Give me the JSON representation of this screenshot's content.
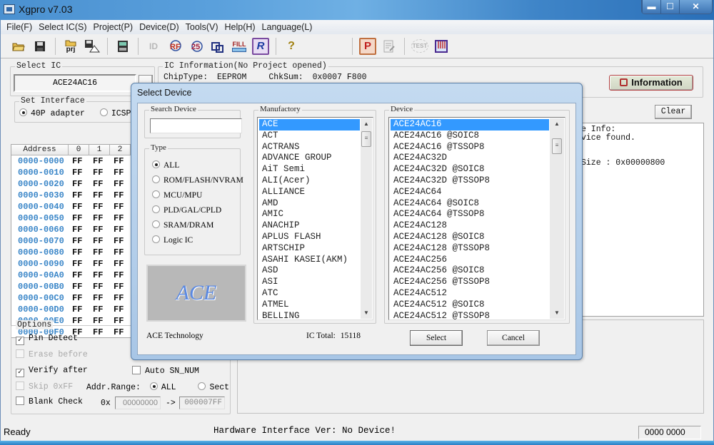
{
  "window": {
    "title": "Xgpro v7.03",
    "minimize": "▬",
    "maximize": "☐",
    "close": "✕"
  },
  "menu": [
    "File(F)",
    "Select IC(S)",
    "Project(P)",
    "Device(D)",
    "Tools(V)",
    "Help(H)",
    "Language(L)"
  ],
  "toolbar": {
    "icons": [
      "open-folder-icon",
      "save-icon",
      "open-project-icon",
      "save-project-icon",
      "chip-read-icon",
      "read-disabled-icon",
      "verify-icon",
      "blank-check-icon",
      "erase-icon",
      "fill-icon",
      "read-id-icon",
      "help-icon",
      "program-icon",
      "edit-disabled-icon",
      "test-icon",
      "chip-pins-icon"
    ],
    "fill_label": "FILL",
    "prj_label": "prj",
    "r_label": "R",
    "p_label": "P",
    "test_label": "TEST",
    "help_glyph": "?"
  },
  "select_ic": {
    "legend": "Select IC",
    "value": "ACE24AC16"
  },
  "ic_info": {
    "legend": "IC Information(No Project opened)",
    "chip_type_label": "ChipType:",
    "chip_type": "EEPROM",
    "chksum_label": "ChkSum:",
    "chksum": "0x0007 F800",
    "information_button": "Information"
  },
  "set_interface": {
    "legend": "Set Interface",
    "options": [
      {
        "label": "40P adapter",
        "selected": true
      },
      {
        "label": "ICSP po",
        "selected": false
      }
    ]
  },
  "hex_table": {
    "headers": [
      "Address",
      "0",
      "1",
      "2"
    ],
    "rows": [
      {
        "addr": "0000-0000",
        "cells": [
          "FF",
          "FF",
          "FF"
        ]
      },
      {
        "addr": "0000-0010",
        "cells": [
          "FF",
          "FF",
          "FF"
        ]
      },
      {
        "addr": "0000-0020",
        "cells": [
          "FF",
          "FF",
          "FF"
        ]
      },
      {
        "addr": "0000-0030",
        "cells": [
          "FF",
          "FF",
          "FF"
        ]
      },
      {
        "addr": "0000-0040",
        "cells": [
          "FF",
          "FF",
          "FF"
        ]
      },
      {
        "addr": "0000-0050",
        "cells": [
          "FF",
          "FF",
          "FF"
        ]
      },
      {
        "addr": "0000-0060",
        "cells": [
          "FF",
          "FF",
          "FF"
        ]
      },
      {
        "addr": "0000-0070",
        "cells": [
          "FF",
          "FF",
          "FF"
        ]
      },
      {
        "addr": "0000-0080",
        "cells": [
          "FF",
          "FF",
          "FF"
        ]
      },
      {
        "addr": "0000-0090",
        "cells": [
          "FF",
          "FF",
          "FF"
        ]
      },
      {
        "addr": "0000-00A0",
        "cells": [
          "FF",
          "FF",
          "FF"
        ]
      },
      {
        "addr": "0000-00B0",
        "cells": [
          "FF",
          "FF",
          "FF"
        ]
      },
      {
        "addr": "0000-00C0",
        "cells": [
          "FF",
          "FF",
          "FF"
        ]
      },
      {
        "addr": "0000-00D0",
        "cells": [
          "FF",
          "FF",
          "FF"
        ]
      },
      {
        "addr": "0000-00E0",
        "cells": [
          "FF",
          "FF",
          "FF"
        ]
      },
      {
        "addr": "0000-00F0",
        "cells": [
          "FF",
          "FF",
          "FF"
        ]
      }
    ]
  },
  "log": {
    "clear_button": "Clear",
    "lines": [
      "e Info:",
      "vice found.",
      "",
      "Size : 0x00000800"
    ]
  },
  "options": {
    "legend": "Options",
    "pin_detect": {
      "label": "Pin Detect",
      "checked": true,
      "enabled": true
    },
    "erase_before": {
      "label": "Erase before",
      "checked": false,
      "enabled": false
    },
    "verify_after": {
      "label": "Verify after",
      "checked": true,
      "enabled": true
    },
    "skip_ff": {
      "label": "Skip 0xFF",
      "checked": false,
      "enabled": false
    },
    "blank_check": {
      "label": "Blank Check",
      "checked": false,
      "enabled": true
    },
    "auto_sn": {
      "label": "Auto SN_NUM",
      "checked": false,
      "enabled": true
    },
    "addr_range_label": "Addr.Range:",
    "addr_range_all": "ALL",
    "addr_range_sect": "Sect",
    "addr_range_selected": "ALL",
    "hex_prefix": "0x",
    "addr_from": "00000000",
    "arrow": "->",
    "addr_to": "000007FF"
  },
  "status": {
    "ready": "Ready",
    "hardware": "Hardware Interface Ver: No Device!",
    "counter": "0000 0000"
  },
  "dialog": {
    "title": "Select Device",
    "search_legend": "Search Device",
    "search_value": "",
    "type_legend": "Type",
    "types": [
      {
        "label": "ALL",
        "selected": true
      },
      {
        "label": "ROM/FLASH/NVRAM",
        "selected": false
      },
      {
        "label": "MCU/MPU",
        "selected": false
      },
      {
        "label": "PLD/GAL/CPLD",
        "selected": false
      },
      {
        "label": "SRAM/DRAM",
        "selected": false
      },
      {
        "label": "Logic IC",
        "selected": false
      }
    ],
    "logo_text": "ACE",
    "manufacturer_name": "ACE Technology",
    "manufactory_legend": "Manufactory",
    "manufacturers": [
      "ACE",
      "ACT",
      "ACTRANS",
      "ADVANCE GROUP",
      "AiT Semi",
      "ALI(Acer)",
      "ALLIANCE",
      "AMD",
      "AMIC",
      "ANACHIP",
      "APLUS FLASH",
      "ARTSCHIP",
      "ASAHI KASEI(AKM)",
      "ASD",
      "ASI",
      "ATC",
      "ATMEL",
      "BELLING"
    ],
    "selected_manufacturer": "ACE",
    "device_legend": "Device",
    "devices": [
      "ACE24AC16",
      "ACE24AC16 @SOIC8",
      "ACE24AC16 @TSSOP8",
      "ACE24AC32D",
      "ACE24AC32D @SOIC8",
      "ACE24AC32D @TSSOP8",
      "ACE24AC64",
      "ACE24AC64 @SOIC8",
      "ACE24AC64 @TSSOP8",
      "ACE24AC128",
      "ACE24AC128 @SOIC8",
      "ACE24AC128 @TSSOP8",
      "ACE24AC256",
      "ACE24AC256 @SOIC8",
      "ACE24AC256 @TSSOP8",
      "ACE24AC512",
      "ACE24AC512 @SOIC8",
      "ACE24AC512 @TSSOP8"
    ],
    "selected_device": "ACE24AC16",
    "ic_total_label": "IC Total:",
    "ic_total": "15118",
    "select_button": "Select",
    "cancel_button": "Cancel"
  },
  "colors": {
    "selection": "#3399ff",
    "address": "#3a86c8",
    "information_border": "#b04040"
  }
}
